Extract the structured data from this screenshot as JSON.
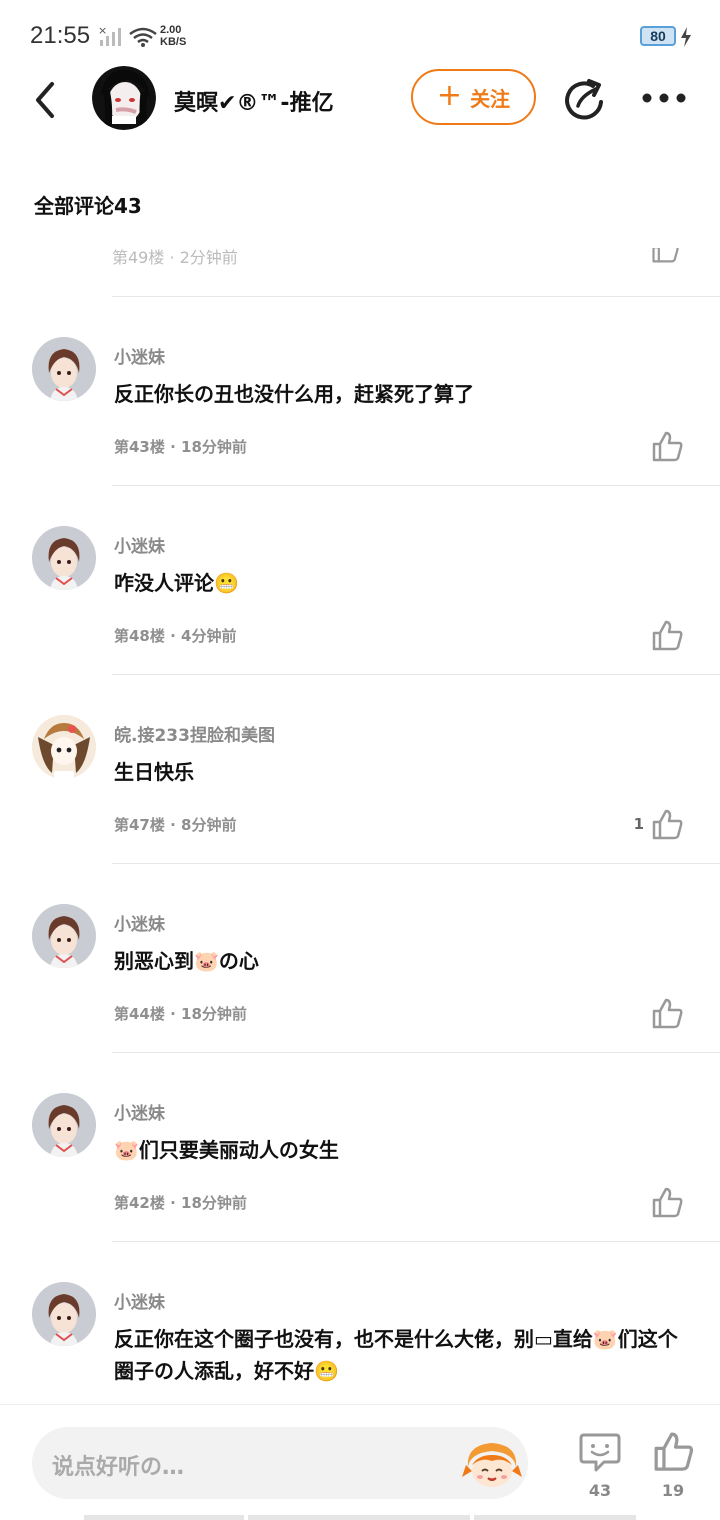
{
  "status": {
    "time": "21:55",
    "net_speed": "2.00",
    "net_unit": "KB/S",
    "battery": "80"
  },
  "header": {
    "title": "莫暝✔®™-推亿",
    "follow_label": "关注"
  },
  "comments_header": "全部评论43",
  "partial_row_ghost": "第49楼 · 2分钟前",
  "comments": [
    {
      "user": "小迷妹",
      "text": "反正你长の丑也没什么用，赶紧死了算了",
      "floor": "第43楼",
      "time": "18分钟前",
      "likes": ""
    },
    {
      "user": "小迷妹",
      "text": "咋没人评论😬",
      "floor": "第48楼",
      "time": "4分钟前",
      "likes": ""
    },
    {
      "user": "皖.接233捏脸和美图",
      "text": "生日快乐",
      "floor": "第47楼",
      "time": "8分钟前",
      "likes": "1"
    },
    {
      "user": "小迷妹",
      "text": "别恶心到🐷の心",
      "floor": "第44楼",
      "time": "18分钟前",
      "likes": ""
    },
    {
      "user": "小迷妹",
      "text": "🐷们只要美丽动人の女生",
      "floor": "第42楼",
      "time": "18分钟前",
      "likes": ""
    },
    {
      "user": "小迷妹",
      "text": "反正你在这个圈子也没有，也不是什么大佬，别▭直给🐷们这个圈子の人添乱，好不好😬",
      "floor": "",
      "time": "",
      "likes": ""
    }
  ],
  "bottom": {
    "input_placeholder": "说点好听の…",
    "comment_count": "43",
    "like_count": "19"
  },
  "colors": {
    "accent": "#f07a17",
    "meta": "#8f8f8f",
    "divider": "#e6e6e6"
  }
}
